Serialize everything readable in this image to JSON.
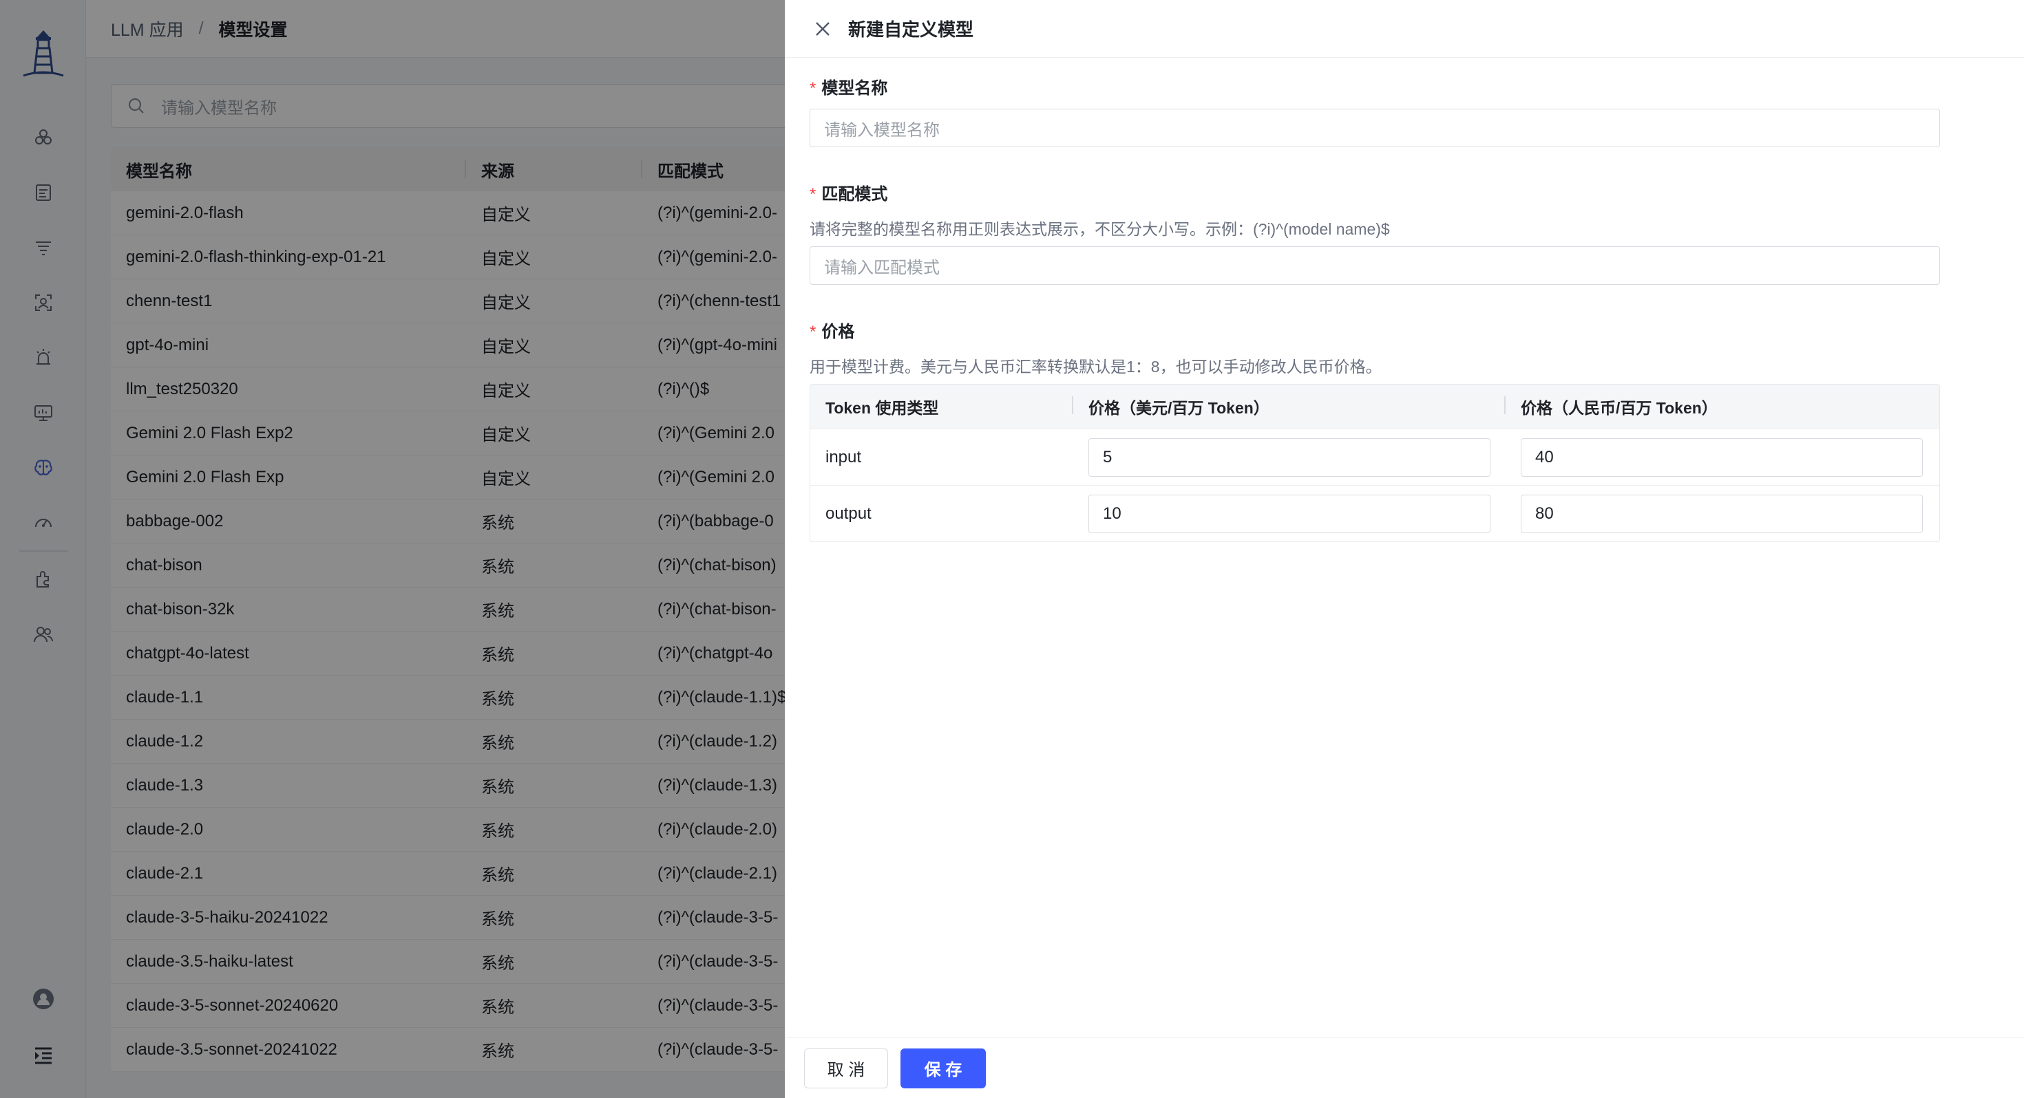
{
  "breadcrumb": {
    "app": "LLM 应用",
    "separator": "/",
    "current": "模型设置"
  },
  "search": {
    "placeholder": "请输入模型名称"
  },
  "table": {
    "headers": [
      "模型名称",
      "来源",
      "匹配模式"
    ],
    "rows": [
      [
        "gemini-2.0-flash",
        "自定义",
        "(?i)^(gemini-2.0-"
      ],
      [
        "gemini-2.0-flash-thinking-exp-01-21",
        "自定义",
        "(?i)^(gemini-2.0-"
      ],
      [
        "chenn-test1",
        "自定义",
        "(?i)^(chenn-test1"
      ],
      [
        "gpt-4o-mini",
        "自定义",
        "(?i)^(gpt-4o-mini"
      ],
      [
        "llm_test250320",
        "自定义",
        "(?i)^()$"
      ],
      [
        "Gemini 2.0 Flash Exp2",
        "自定义",
        "(?i)^(Gemini 2.0"
      ],
      [
        "Gemini 2.0 Flash Exp",
        "自定义",
        "(?i)^(Gemini 2.0"
      ],
      [
        "babbage-002",
        "系统",
        "(?i)^(babbage-0"
      ],
      [
        "chat-bison",
        "系统",
        "(?i)^(chat-bison)"
      ],
      [
        "chat-bison-32k",
        "系统",
        "(?i)^(chat-bison-"
      ],
      [
        "chatgpt-4o-latest",
        "系统",
        "(?i)^(chatgpt-4o"
      ],
      [
        "claude-1.1",
        "系统",
        "(?i)^(claude-1.1)$"
      ],
      [
        "claude-1.2",
        "系统",
        "(?i)^(claude-1.2)"
      ],
      [
        "claude-1.3",
        "系统",
        "(?i)^(claude-1.3)"
      ],
      [
        "claude-2.0",
        "系统",
        "(?i)^(claude-2.0)"
      ],
      [
        "claude-2.1",
        "系统",
        "(?i)^(claude-2.1)"
      ],
      [
        "claude-3-5-haiku-20241022",
        "系统",
        "(?i)^(claude-3-5-"
      ],
      [
        "claude-3.5-haiku-latest",
        "系统",
        "(?i)^(claude-3-5-"
      ],
      [
        "claude-3-5-sonnet-20240620",
        "系统",
        "(?i)^(claude-3-5-"
      ],
      [
        "claude-3.5-sonnet-20241022",
        "系统",
        "(?i)^(claude-3-5-"
      ]
    ]
  },
  "nav_icons": [
    "models-icon",
    "document-icon",
    "filter-list-icon",
    "face-scan-icon",
    "alert-icon",
    "monitor-icon",
    "brain-icon",
    "dashboard-icon",
    "plugin-icon",
    "users-icon"
  ],
  "drawer": {
    "title": "新建自定义模型",
    "name_field": {
      "label": "模型名称",
      "placeholder": "请输入模型名称"
    },
    "pattern_field": {
      "label": "匹配模式",
      "hint": "请将完整的模型名称用正则表达式展示，不区分大小写。示例：(?i)^(model name)$",
      "placeholder": "请输入匹配模式"
    },
    "price_field": {
      "label": "价格",
      "hint": "用于模型计费。美元与人民币汇率转换默认是1：8，也可以手动修改人民币价格。",
      "headers": [
        "Token 使用类型",
        "价格（美元/百万 Token）",
        "价格（人民币/百万 Token）"
      ],
      "rows": [
        {
          "type": "input",
          "usd": "5",
          "cny": "40"
        },
        {
          "type": "output",
          "usd": "10",
          "cny": "80"
        }
      ]
    },
    "cancel_label": "取 消",
    "save_label": "保 存"
  },
  "colors": {
    "accent": "#3b5bff",
    "required": "#f53f3f",
    "nav_active": "#4a63d8"
  }
}
